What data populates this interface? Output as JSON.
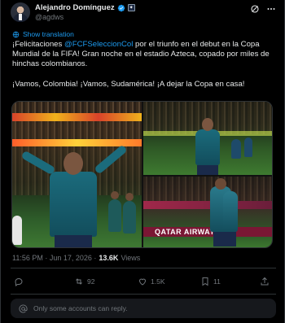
{
  "author": {
    "name": "Alejandro Domínguez",
    "handle": "@agdws"
  },
  "header_icons": [
    "grok-icon",
    "more-icon"
  ],
  "translate_label": "Show translation",
  "tweet": {
    "line1_pre": "¡Felicitaciones ",
    "mention": "@FCFSeleccionCol",
    "line1_post": " por el triunfo en el debut en la Copa Mundial de la FIFA! Gran noche en el estadio Azteca, copado por miles de hinchas colombianos.",
    "line2": "¡Vamos, Colombia! ¡Vamos, Sudamérica! ¡A dejar la Copa en casa!"
  },
  "media": {
    "banner_text": "QATAR AIRWAYS",
    "count": 3
  },
  "meta": {
    "time": "11:56 PM · Jun 17, 2026 · ",
    "views": "13.6K",
    "views_label": " Views"
  },
  "actions": {
    "replies": "",
    "reposts": "92",
    "likes": "1.5K",
    "bookmarks": "11"
  },
  "reply_restriction": "Only some accounts can reply.",
  "colors": {
    "background": "#000000",
    "text": "#e7e9ea",
    "secondary": "#71767b",
    "accent": "#1d9bf0",
    "border": "#2f3336"
  }
}
